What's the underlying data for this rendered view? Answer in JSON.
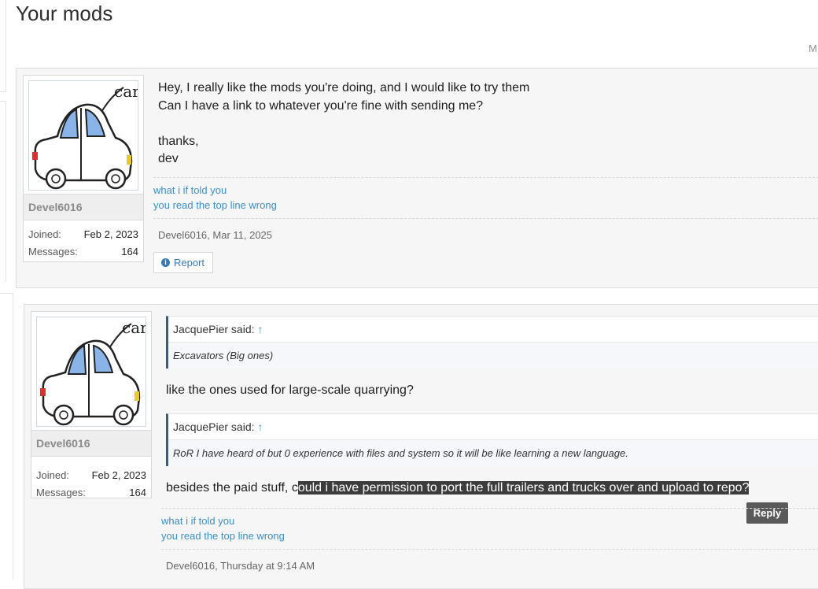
{
  "page": {
    "title": "Your mods",
    "corner_text": "M"
  },
  "posts": [
    {
      "author": {
        "name": "Devel6016",
        "joined_label": "Joined:",
        "joined": "Feb 2, 2023",
        "messages_label": "Messages:",
        "messages": "164",
        "avatar_text": "car"
      },
      "body_lines": [
        "Hey, I really like the mods you're doing, and I would like to try them",
        "Can I have a link to whatever you're fine with sending me?",
        "",
        "thanks,",
        "dev"
      ],
      "signature": [
        "what i if told you",
        "you read the top line wrong"
      ],
      "meta": "Devel6016, Mar 11, 2025",
      "report_label": "Report"
    },
    {
      "author": {
        "name": "Devel6016",
        "joined_label": "Joined:",
        "joined": "Feb 2, 2023",
        "messages_label": "Messages:",
        "messages": "164",
        "avatar_text": "car"
      },
      "quotes": [
        {
          "author": "JacquePier said:",
          "arrow": "↑",
          "text": "Excavators (Big ones)"
        },
        {
          "author": "JacquePier said:",
          "arrow": "↑",
          "text": "RoR I have heard of but 0 experience with files and system so it will be like learning a new language."
        }
      ],
      "reply_text_1": "like the ones used for large-scale quarrying?",
      "reply_text_2_plain": "besides the paid stuff, c",
      "reply_text_2_selected": "ould i have permission to port the full trailers and trucks over and upload to repo?",
      "reply_label": "Reply",
      "signature": [
        "what i if told you",
        "you read the top line wrong"
      ],
      "meta": "Devel6016, Thursday at 9:14 AM"
    }
  ],
  "colors": {
    "link": "#3a8fc8",
    "quote_bar": "#3e5a7a",
    "selection": "#3c3c3c"
  }
}
